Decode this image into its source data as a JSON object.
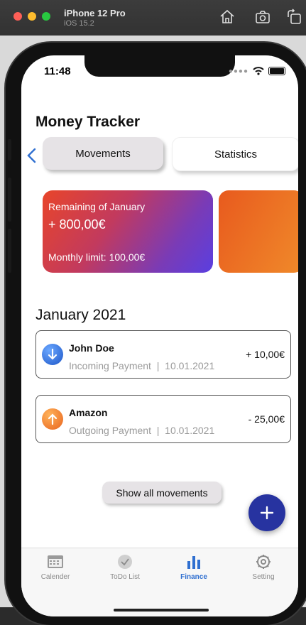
{
  "simulator": {
    "device_name": "iPhone 12 Pro",
    "os_version": "iOS 15.2",
    "home_icon": "home-icon",
    "screenshot_icon": "screenshot-icon",
    "rotate_icon": "rotate-icon"
  },
  "status_bar": {
    "time": "11:48"
  },
  "header": {
    "title": "Money Tracker"
  },
  "segments": {
    "movements": "Movements",
    "statistics": "Statistics"
  },
  "card": {
    "title": "Remaining of January",
    "amount": "+ 800,00€",
    "limit": "Monthly limit: 100,00€"
  },
  "month": "January 2021",
  "movements": [
    {
      "name": "John Doe",
      "type": "Incoming Payment",
      "date": "10.01.2021",
      "amount": "+ 10,00€",
      "icon": "arrow-down-icon"
    },
    {
      "name": "Amazon",
      "type": "Outgoing Payment",
      "date": "10.01.2021",
      "amount": "- 25,00€",
      "icon": "arrow-up-icon"
    }
  ],
  "separator": "|",
  "show_all": "Show all movements",
  "tabs": [
    {
      "label": "Calender",
      "icon": "calendar-icon"
    },
    {
      "label": "ToDo List",
      "icon": "checkmark-icon"
    },
    {
      "label": "Finance",
      "icon": "bar-chart-icon"
    },
    {
      "label": "Setting",
      "icon": "gear-icon"
    }
  ],
  "colors": {
    "accent": "#2f6fd0",
    "fab": "#2733a0",
    "incoming": "#1e57c8",
    "outgoing": "#e8641e"
  }
}
